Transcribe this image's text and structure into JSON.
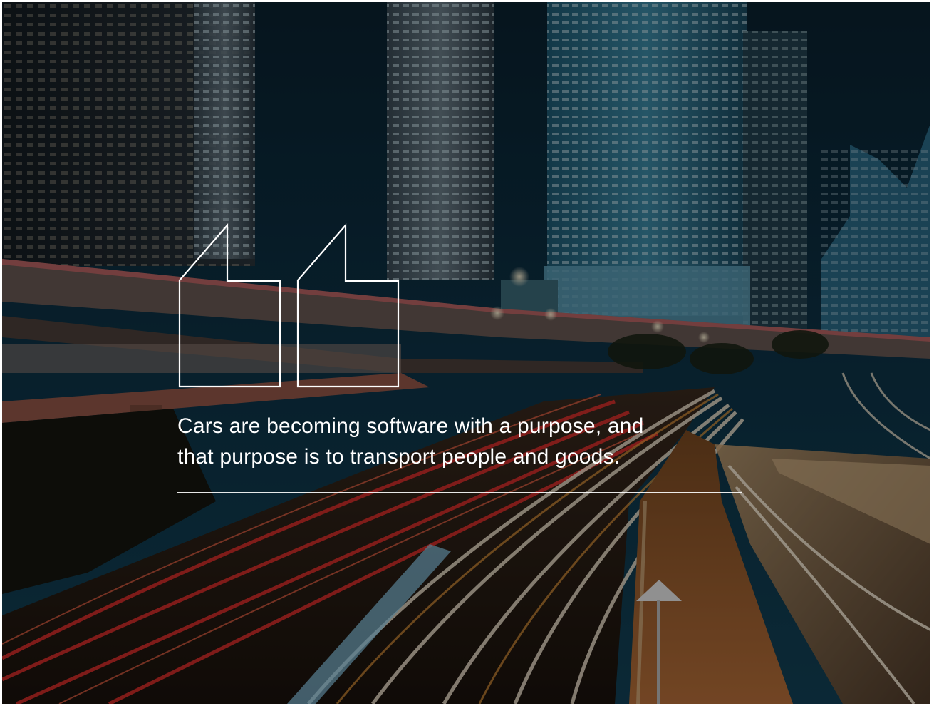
{
  "quote": {
    "lines": [
      "Cars are becoming software with a purpose, and",
      "that purpose is to transport people and goods."
    ]
  },
  "icons": {
    "quote_mark": "open-quote-outline-icon"
  },
  "colors": {
    "text": "#ffffff",
    "overlay": "rgba(0,0,0,0.38)",
    "sky": "#0b2a3a",
    "light_trail_red": "#e0302c",
    "light_trail_white": "#f3e6d0",
    "light_trail_amber": "#e89a3c"
  }
}
